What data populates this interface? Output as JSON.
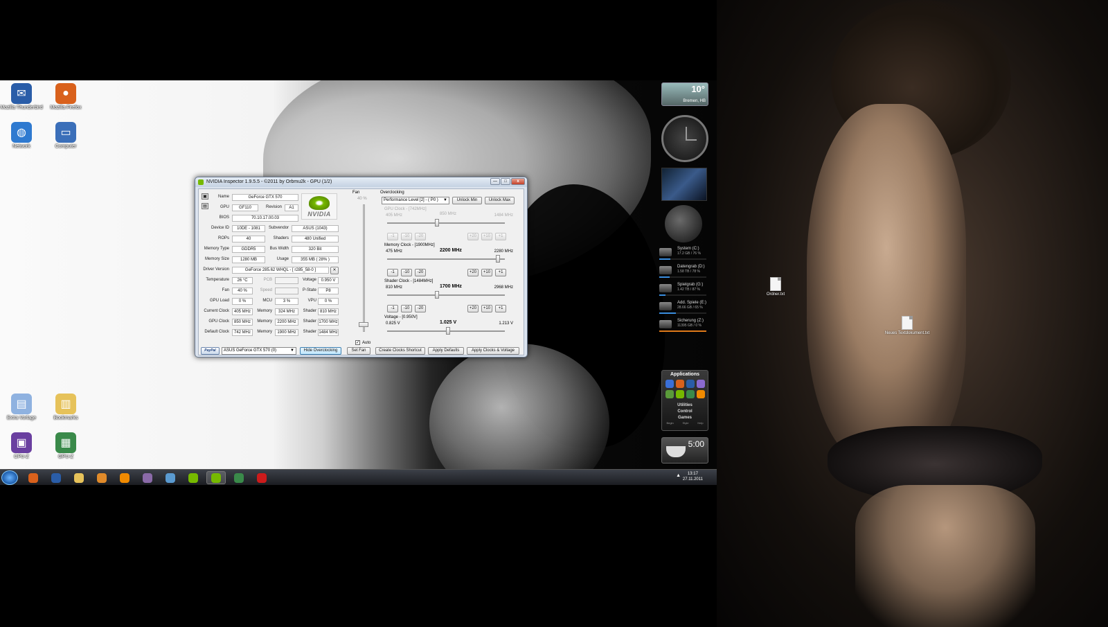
{
  "desktop_icons_left": [
    {
      "label": "Mozilla Thunderbird",
      "icon": "thunderbird-icon",
      "color": "#2a5da8"
    },
    {
      "label": "Mozilla Firefox",
      "icon": "firefox-icon",
      "color": "#d9611c"
    },
    {
      "label": "Network",
      "icon": "network-icon",
      "color": "#2f7ad0"
    },
    {
      "label": "Computer",
      "icon": "computer-icon",
      "color": "#3b6fb9"
    },
    {
      "label": "Extra Vorlage",
      "icon": "document-icon",
      "color": "#8fb2e0"
    },
    {
      "label": "Bookmarks",
      "icon": "folder-icon",
      "color": "#e6c25a"
    },
    {
      "label": "CPU-Z",
      "icon": "cpuz-icon",
      "color": "#6a3fa0"
    },
    {
      "label": "GPU-Z",
      "icon": "gpuz-icon",
      "color": "#3a8a4a"
    }
  ],
  "desktop_icons_right": [
    {
      "label": "Ordner.txt",
      "icon": "text-file-icon"
    },
    {
      "label": "Neues Textdokument.txt",
      "icon": "text-file-icon"
    }
  ],
  "gadgets": {
    "weather": {
      "temp": "10°",
      "city": "Bremen, HB"
    },
    "drives": [
      {
        "name": "System (C:)",
        "info": "17.2 GB / 76 %",
        "fill": 0.24
      },
      {
        "name": "Datengrab (D:)",
        "info": "1.58 TB / 78 %",
        "fill": 0.22
      },
      {
        "name": "Spielgrab (G:)",
        "info": "1.42 TB / 87 %",
        "fill": 0.13
      },
      {
        "name": "Add. Spiele (E:)",
        "info": "28.66 GB / 65 %",
        "fill": 0.35
      },
      {
        "name": "Sicherung (Z:)",
        "info": "11395 GB / 0 %",
        "fill": 1.0
      }
    ],
    "apps": {
      "title": "Applications",
      "menu": [
        "Utilities",
        "Control",
        "Games"
      ],
      "footer": [
        "Begin",
        "Style",
        "Help"
      ]
    },
    "timer": {
      "time": "5:00"
    }
  },
  "taskbar": {
    "buttons": [
      {
        "name": "firefox",
        "icon": "firefox-icon",
        "color": "#d9611c"
      },
      {
        "name": "thunderbird",
        "icon": "thunderbird-icon",
        "color": "#2a5da8"
      },
      {
        "name": "explorer",
        "icon": "folder-icon",
        "color": "#e6c25a"
      },
      {
        "name": "media-player",
        "icon": "play-icon",
        "color": "#e08a2a"
      },
      {
        "name": "vlc",
        "icon": "vlc-icon",
        "color": "#f08a00"
      },
      {
        "name": "app-purple",
        "icon": "app-icon",
        "color": "#8a6aa8"
      },
      {
        "name": "network-tool",
        "icon": "network-icon",
        "color": "#5a9ad0"
      },
      {
        "name": "nvidia-tool-1",
        "icon": "nvidia-icon",
        "color": "#76b900"
      },
      {
        "name": "nvidia-inspector",
        "icon": "nvidia-icon",
        "color": "#76b900"
      },
      {
        "name": "gpu-z",
        "icon": "gpuz-icon",
        "color": "#3a8a4a"
      },
      {
        "name": "opera",
        "icon": "opera-icon",
        "color": "#cc1b1b"
      }
    ],
    "time": "13:17",
    "date": "27.11.2011"
  },
  "inspector": {
    "title": "NVIDIA Inspector 1.9.5.5 - ©2011 by Orbmu2k - GPU (1/2)",
    "close": "x",
    "info": {
      "name": "GeForce GTX 570",
      "gpu": "GF110",
      "revision": "A1",
      "bios": "70.10.17.00.03",
      "device_id": "10DE - 1081",
      "subvendor": "ASUS (1043)",
      "rops": "40",
      "shaders": "480 Unified",
      "memory_type": "GDDR5",
      "bus_width": "320 Bit",
      "memory_size": "1280 MB",
      "usage": "355 MB ( 28% )",
      "driver_version": "GeForce 285.62 WHQL - [ r285_58-0 ]",
      "temperature": "26 °C",
      "pcb": "",
      "voltage": "0.950 V",
      "fan": "40 %",
      "speed": "",
      "pstate": "P8",
      "gpu_load": "0 %",
      "mcu": "3 %",
      "vpu": "0 %",
      "current_clock": "405 MHz",
      "current_memory": "324 MHz",
      "current_shader": "810 MHz",
      "gpu_clock": "850 MHz",
      "gpu_memory": "2200 MHz",
      "gpu_shader": "1700 MHz",
      "default_clock": "742 MHz",
      "default_memory": "1900 MHz",
      "default_shader": "1484 MHz"
    },
    "labels": {
      "name": "Name",
      "gpu": "GPU",
      "revision": "Revision",
      "bios": "BIOS",
      "device_id": "Device ID",
      "subvendor": "Subvendor",
      "rops": "ROPs",
      "shaders": "Shaders",
      "memory_type": "Memory Type",
      "bus_width": "Bus Width",
      "memory_size": "Memory Size",
      "usage": "Usage",
      "driver_version": "Driver Version",
      "temperature": "Temperature",
      "pcb": "PCB",
      "voltage": "Voltage",
      "fan": "Fan",
      "speed": "Speed",
      "pstate": "P-State",
      "gpu_load": "GPU Load",
      "mcu": "MCU",
      "vpu": "VPU",
      "current_clock": "Current Clock",
      "gpu_clock": "GPU Clock",
      "default_clock": "Default Clock",
      "memory": "Memory",
      "shader": "Shader"
    },
    "logo_text": "NVIDIA",
    "fan_panel": {
      "title": "Fan",
      "value": "40 %",
      "auto_label": "Auto",
      "auto_checked": "✓"
    },
    "overclocking": {
      "title": "Overclocking",
      "performance_level": "Performance Level [2] - ( P0 )",
      "unlock_min": "Unlock Min",
      "unlock_max": "Unlock Max",
      "gpu_clock": {
        "title": "GPU Clock - [742MHz]",
        "min": "405 MHz",
        "current": "850 MHz",
        "max": "1484 MHz",
        "level": 0.42
      },
      "memory_clock": {
        "title": "Memory Clock - [1900MHz]",
        "min": "475 MHz",
        "current": "2200 MHz",
        "max": "2280 MHz",
        "level": 0.96
      },
      "shader_clock": {
        "title": "Shader Clock - [1484MHz]",
        "min": "810 MHz",
        "current": "1700 MHz",
        "max": "2968 MHz",
        "level": 0.42
      },
      "voltage": {
        "title": "Voltage - [0.950V]",
        "min": "0.825 V",
        "current": "1.025 V",
        "max": "1.213 V",
        "level": 0.52
      },
      "step_buttons_left": [
        "-1",
        "-10",
        "-20"
      ],
      "step_buttons_right": [
        "+20",
        "+10",
        "+1"
      ]
    },
    "bottom": {
      "paypal": "PayPal",
      "gpu_select": "ASUS GeForce GTX 570 (0)",
      "hide_overclocking": "Hide Overclocking",
      "set_fan": "Set Fan",
      "create_shortcut": "Create Clocks Shortcut",
      "apply_defaults": "Apply Defaults",
      "apply_clocks": "Apply Clocks & Voltage"
    }
  },
  "colors": {
    "nvidia_green": "#76b900",
    "drive_bar": "#3a8ee0",
    "drive_bar_full": "#e07a1a"
  }
}
